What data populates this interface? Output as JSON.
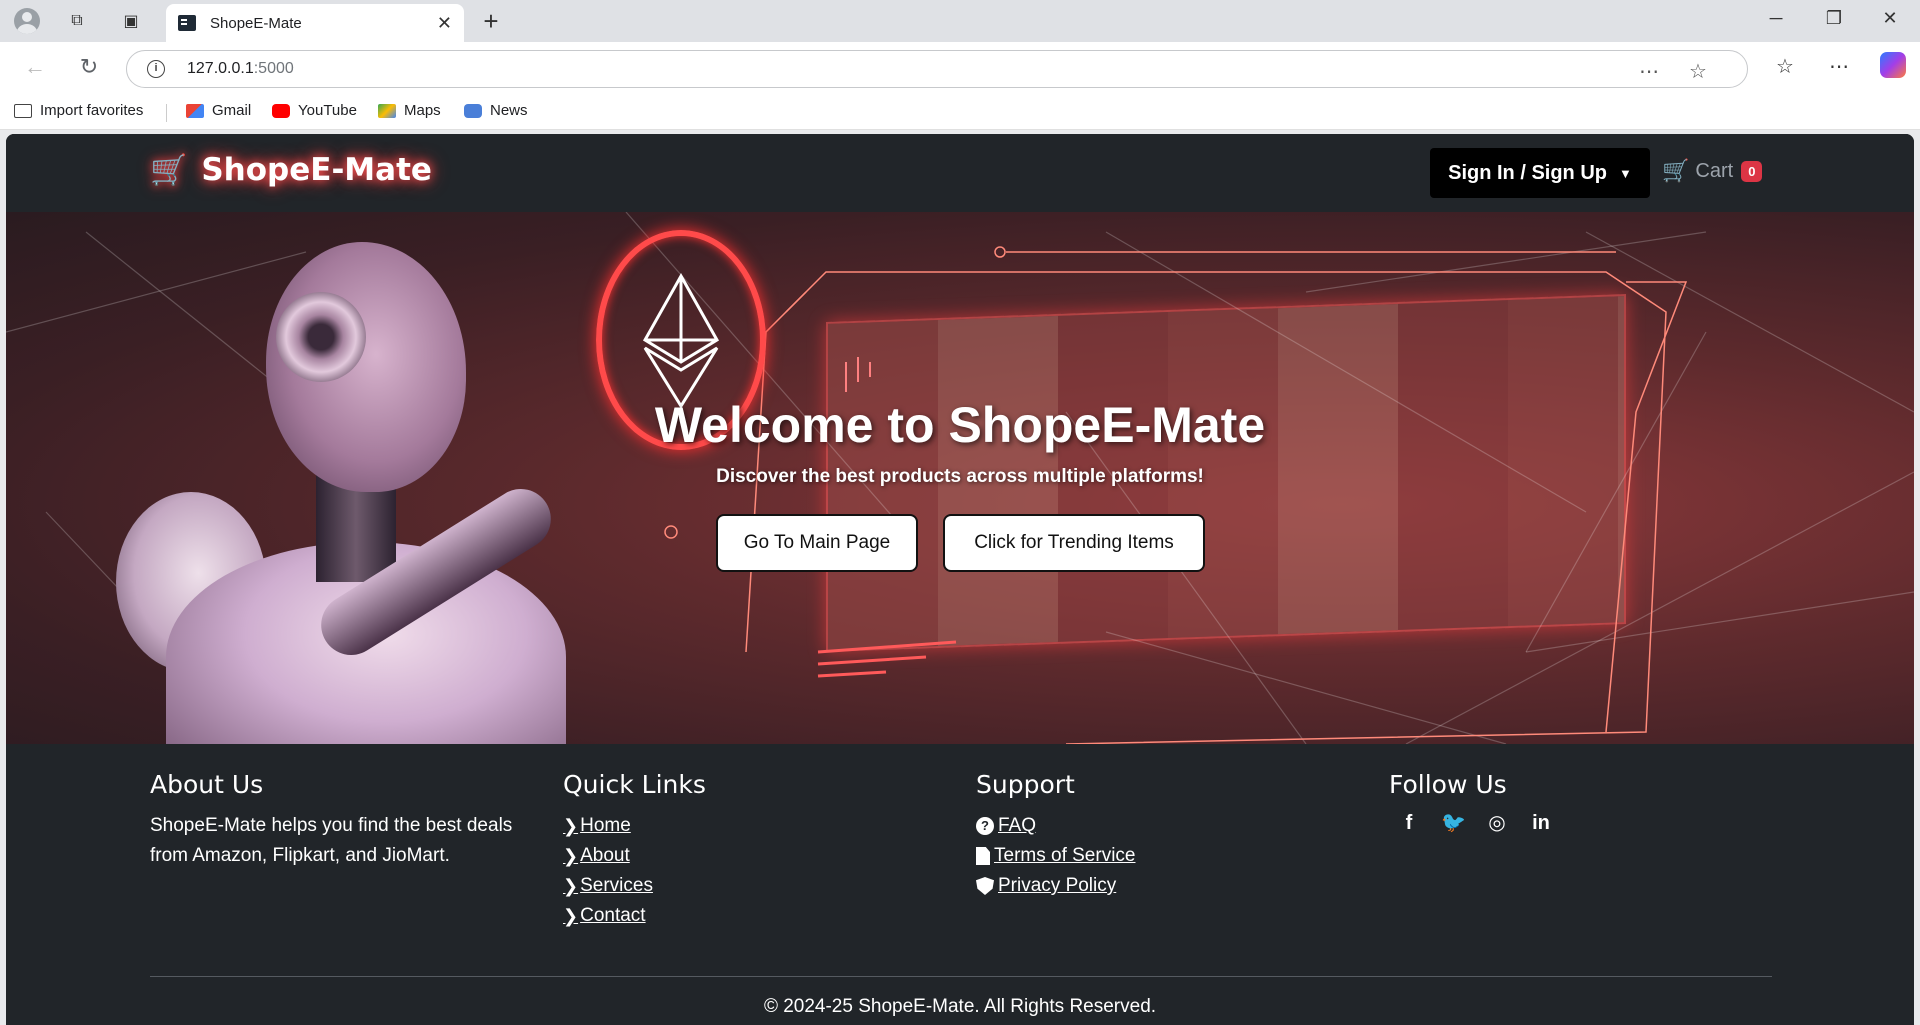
{
  "browser": {
    "tab_title": "ShopeE-Mate",
    "url_host": "127.0.0.1",
    "url_port": ":5000",
    "bookmarks": [
      {
        "label": "Import favorites",
        "icon": "folder-import-icon"
      },
      {
        "label": "Gmail",
        "icon": "gmail-icon"
      },
      {
        "label": "YouTube",
        "icon": "youtube-icon"
      },
      {
        "label": "Maps",
        "icon": "maps-icon"
      },
      {
        "label": "News",
        "icon": "news-icon"
      }
    ]
  },
  "navbar": {
    "brand": "ShopeE-Mate",
    "signin_label": "Sign In / Sign Up",
    "cart_label": "Cart",
    "cart_count": "0"
  },
  "hero": {
    "title": "Welcome to ShopeE-Mate",
    "subtitle": "Discover the best products across multiple platforms!",
    "btn_main": "Go To Main Page",
    "btn_trending": "Click for Trending Items"
  },
  "footer": {
    "about_title": "About Us",
    "about_text": "ShopeE-Mate helps you find the best deals from Amazon, Flipkart, and JioMart.",
    "links_title": "Quick Links",
    "links": [
      "Home",
      "About",
      "Services",
      "Contact"
    ],
    "support_title": "Support",
    "support": [
      "FAQ",
      "Terms of Service",
      "Privacy Policy"
    ],
    "follow_title": "Follow Us",
    "social": [
      "facebook-icon",
      "twitter-icon",
      "instagram-icon",
      "linkedin-icon"
    ],
    "copyright": "© 2024-25 ShopeE-Mate. All Rights Reserved."
  },
  "colors": {
    "page_bg": "#212529",
    "badge": "#dc3545",
    "brand_glow": "#ff4d4d"
  }
}
